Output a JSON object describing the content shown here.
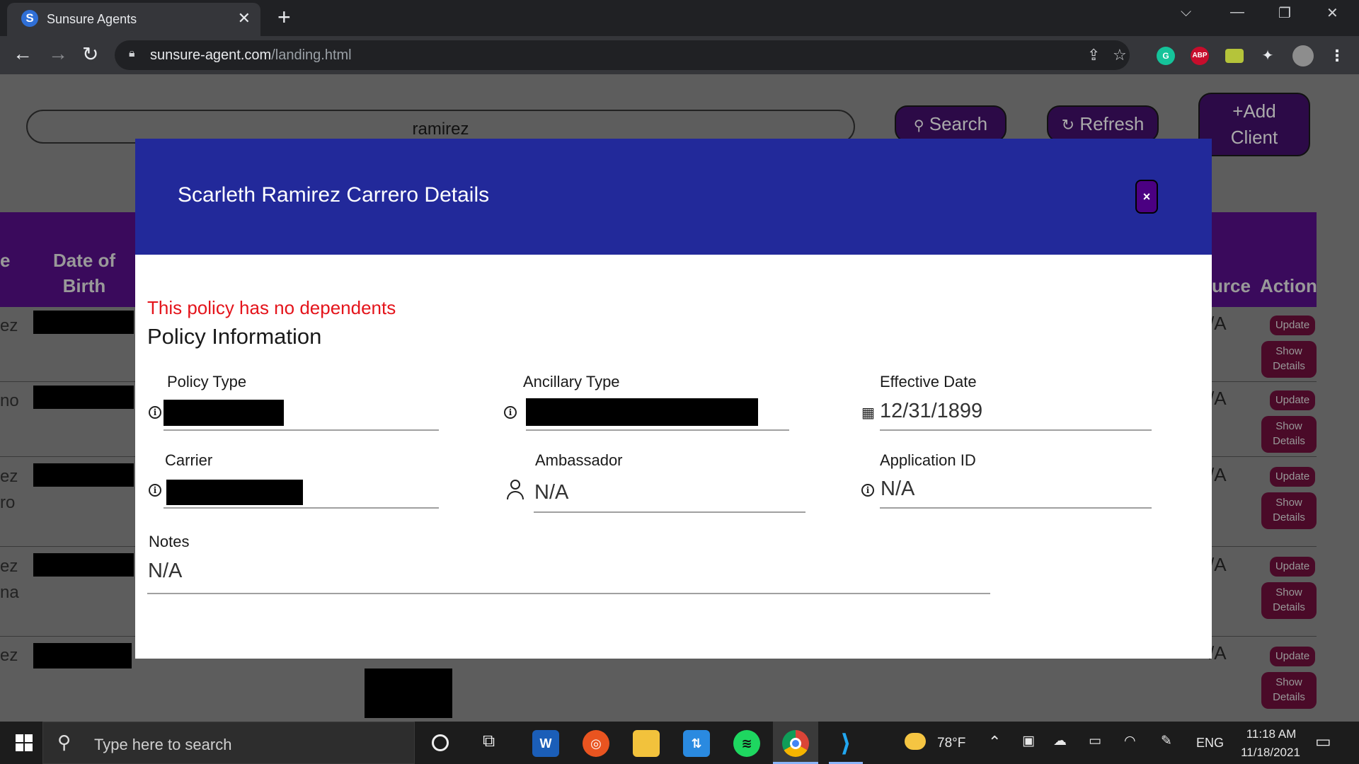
{
  "browser": {
    "tab_title": "Sunsure Agents",
    "tab_favicon_letter": "S",
    "url_host": "sunsure-agent.com",
    "url_path": "/landing.html",
    "extensions": [
      {
        "label": "G",
        "name": "grammarly",
        "color": "#15c39a"
      },
      {
        "label": "ABP",
        "name": "adblock-plus",
        "color": "#c70d2c"
      },
      {
        "label": "",
        "name": "image-extension",
        "color": "#b5c43a"
      }
    ]
  },
  "page": {
    "search_value": "ramirez",
    "search_button": "Search",
    "refresh_button": "Refresh",
    "add_client_line1": "+Add",
    "add_client_line2": "Client",
    "headers": {
      "partial_left_line1": "",
      "partial_left_line2": "e",
      "dob_line1": "Date of",
      "dob_line2": "Birth",
      "source_partial": "urce",
      "action": "Action"
    },
    "rows": [
      {
        "name_line1": "ez",
        "name_line2": "",
        "source": "/A"
      },
      {
        "name_line1": "no",
        "name_line2": "",
        "source": "/A"
      },
      {
        "name_line1": "ez",
        "name_line2": "ro",
        "source": "/A"
      },
      {
        "name_line1": "ez",
        "name_line2": "na",
        "source": "/A"
      },
      {
        "name_line1": "ez",
        "name_line2": "",
        "source": "/A"
      }
    ],
    "update_label": "Update",
    "show_details_line1": "Show",
    "show_details_line2": "Details"
  },
  "modal": {
    "title": "Scarleth Ramirez Carrero Details",
    "close_label": "×",
    "no_dependents": "This policy has no dependents",
    "section_title": "Policy Information",
    "fields": {
      "policy_type": {
        "label": "Policy Type",
        "value": ""
      },
      "ancillary_type": {
        "label": "Ancillary Type",
        "value": ""
      },
      "effective_date": {
        "label": "Effective Date",
        "value": "12/31/1899"
      },
      "carrier": {
        "label": "Carrier",
        "value": ""
      },
      "ambassador": {
        "label": "Ambassador",
        "value": "N/A"
      },
      "application_id": {
        "label": "Application ID",
        "value": "N/A"
      },
      "notes": {
        "label": "Notes",
        "value": "N/A"
      }
    }
  },
  "taskbar": {
    "search_placeholder": "Type here to search",
    "weather": "78°F",
    "language": "ENG",
    "time": "11:18 AM",
    "date": "11/18/2021"
  }
}
